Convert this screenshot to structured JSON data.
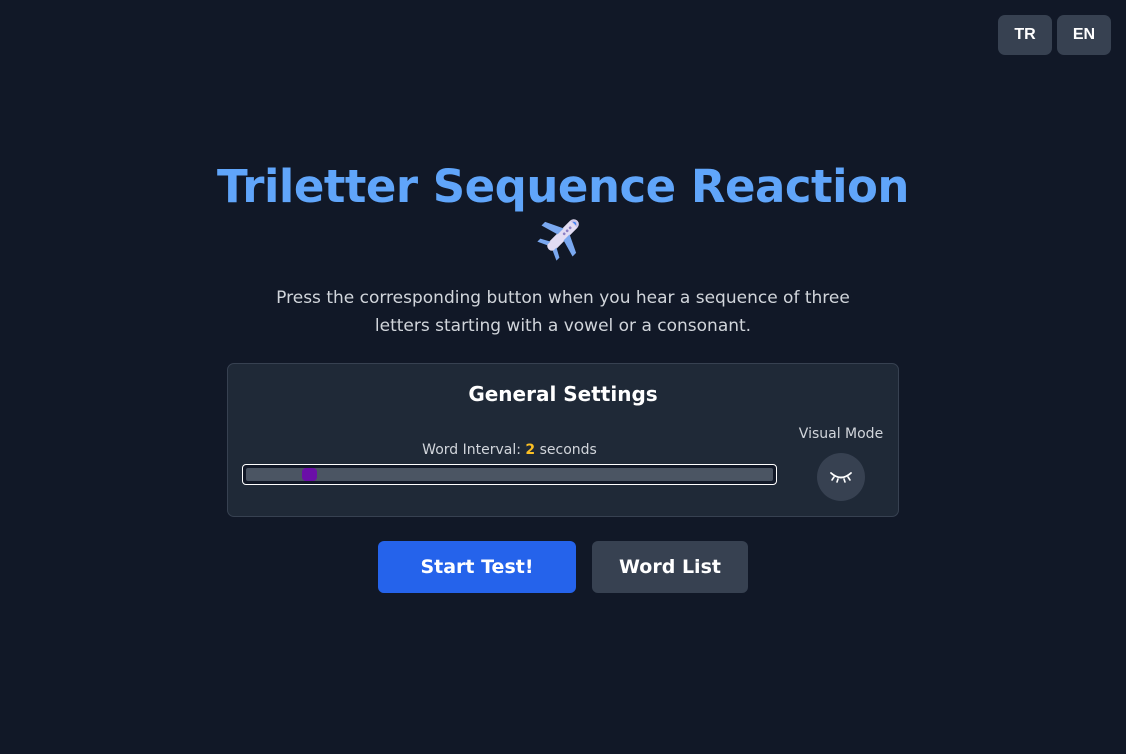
{
  "language": {
    "tr_label": "TR",
    "en_label": "EN"
  },
  "header": {
    "title": "Triletter Sequence Reaction",
    "title_icon": "airplane-icon",
    "description": "Press the corresponding button when you hear a sequence of three letters starting with a vowel or a consonant."
  },
  "settings": {
    "title": "General Settings",
    "interval_prefix": "Word Interval:",
    "interval_value": "2",
    "interval_suffix": "seconds",
    "interval_slider_fraction": 0.12,
    "visual_mode_label": "Visual Mode",
    "visual_mode_icon": "closed-eye-icon"
  },
  "actions": {
    "start_label": "Start Test!",
    "word_list_label": "Word List"
  },
  "colors": {
    "background": "#111827",
    "title": "#60a5fa",
    "accent_value": "#fbbf24",
    "primary_button": "#2563eb",
    "secondary_button": "#374151",
    "slider_thumb": "#6b0fa8"
  }
}
